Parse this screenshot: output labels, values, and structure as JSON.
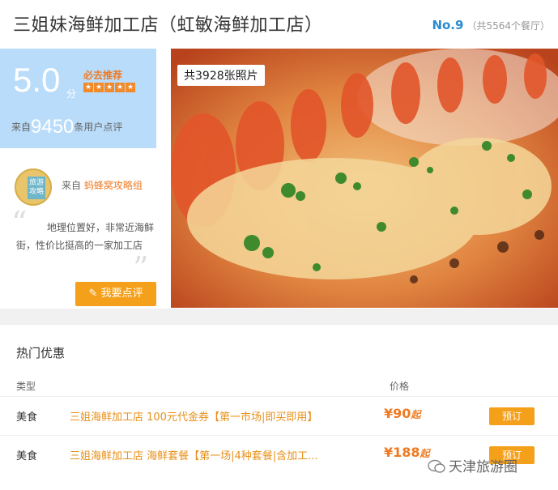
{
  "header": {
    "title": "三姐妹海鲜加工店（虹敏海鲜加工店）",
    "rank_no": "No.9",
    "rank_note": "（共5564个餐厅）"
  },
  "score": {
    "value": "5.0",
    "unit": "分",
    "must_go": "必去推荐",
    "stars": 5,
    "from_prefix": "来自",
    "review_count": "9450",
    "from_suffix": "条用户点评"
  },
  "review": {
    "avatar_text": "旅游攻略",
    "by_prefix": "来自",
    "author": "蚂蜂窝攻略组",
    "quote": "地理位置好，非常近海鲜街，性价比挺高的一家加工店",
    "button": "我要点评"
  },
  "photo": {
    "count_label": "共3928张照片"
  },
  "promotions": {
    "title": "热门优惠",
    "col_type": "类型",
    "col_price": "价格",
    "rows": [
      {
        "type": "美食",
        "name": "三姐海鲜加工店 100元代金券【第一市场|即买即用】",
        "price": "¥90",
        "suffix": "起",
        "button": "预订"
      },
      {
        "type": "美食",
        "name": "三姐海鲜加工店 海鲜套餐【第一场|4种套餐|含加工...",
        "price": "¥188",
        "suffix": "起",
        "button": "预订"
      }
    ]
  },
  "watermark": {
    "text": "天津旅游圈"
  },
  "colors": {
    "accent": "#f5a01a",
    "score_bg": "#b9dcfa",
    "rank_blue": "#2b8bd0"
  }
}
